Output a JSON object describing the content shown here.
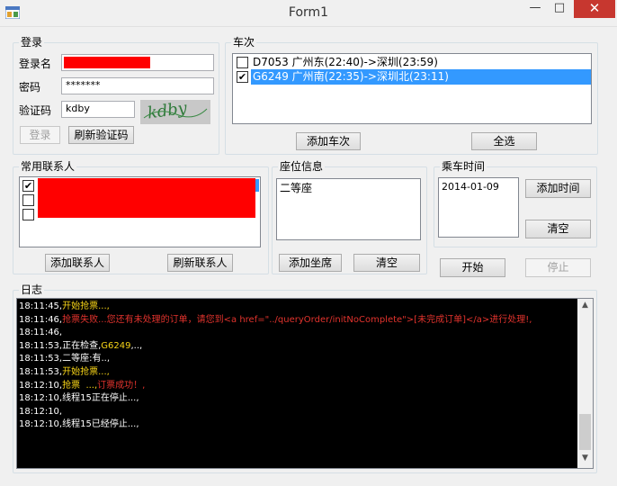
{
  "window": {
    "title": "Form1",
    "minimize": "—",
    "maximize": "□",
    "close": "✕"
  },
  "login": {
    "group_title": "登录",
    "username_label": "登录名",
    "password_label": "密码",
    "password_value": "*******",
    "captcha_label": "验证码",
    "captcha_value": "kdby",
    "captcha_image_text": "kdby",
    "login_button": "登录",
    "refresh_captcha_button": "刷新验证码"
  },
  "trains": {
    "group_title": "车次",
    "items": [
      {
        "label": "D7053 广州东(22:40)->深圳(23:59)",
        "checked": false,
        "selected": false
      },
      {
        "label": "G6249 广州南(22:35)->深圳北(23:11)",
        "checked": true,
        "selected": true
      }
    ],
    "add_button": "添加车次",
    "select_all_button": "全选"
  },
  "contacts": {
    "group_title": "常用联系人",
    "checks": [
      "✔",
      "",
      ""
    ],
    "add_button": "添加联系人",
    "refresh_button": "刷新联系人"
  },
  "seat": {
    "group_title": "座位信息",
    "items": [
      "二等座"
    ],
    "add_button": "添加坐席",
    "clear_button": "清空"
  },
  "date": {
    "group_title": "乘车时间",
    "items": [
      "2014-01-09"
    ],
    "add_button": "添加时间",
    "clear_button": "清空"
  },
  "controls": {
    "start_button": "开始",
    "stop_button": "停止"
  },
  "log": {
    "group_title": "日志",
    "lines": [
      [
        {
          "t": "18:11:45,",
          "c": ""
        },
        {
          "t": "开始抢票...,",
          "c": "yellow"
        }
      ],
      [
        {
          "t": "18:11:46,",
          "c": ""
        },
        {
          "t": "抢票失败...您还有未处理的订单，请您到<a href=\"../queryOrder/initNoComplete\">[未完成订单]</a>进行处理!,",
          "c": "red"
        }
      ],
      [
        {
          "t": "18:11:46,",
          "c": ""
        }
      ],
      [
        {
          "t": "18:11:53,",
          "c": ""
        },
        {
          "t": "正在检查,",
          "c": ""
        },
        {
          "t": "G6249",
          "c": "yellow"
        },
        {
          "t": ",..,",
          "c": ""
        }
      ],
      [
        {
          "t": "18:11:53,",
          "c": ""
        },
        {
          "t": "二等座:有..,",
          "c": ""
        }
      ],
      [
        {
          "t": "18:11:53,",
          "c": ""
        },
        {
          "t": "开始抢票...,",
          "c": "yellow"
        }
      ],
      [
        {
          "t": "18:12:10,",
          "c": ""
        },
        {
          "t": "抢票  ...,",
          "c": "yellow"
        },
        {
          "t": "订票成功！,",
          "c": "red"
        }
      ],
      [
        {
          "t": "18:12:10,",
          "c": ""
        },
        {
          "t": "线程15正在停止...,",
          "c": ""
        }
      ],
      [
        {
          "t": "18:12:10,",
          "c": ""
        }
      ],
      [
        {
          "t": "18:12:10,",
          "c": ""
        },
        {
          "t": "线程15已经停止...,",
          "c": ""
        }
      ]
    ]
  }
}
